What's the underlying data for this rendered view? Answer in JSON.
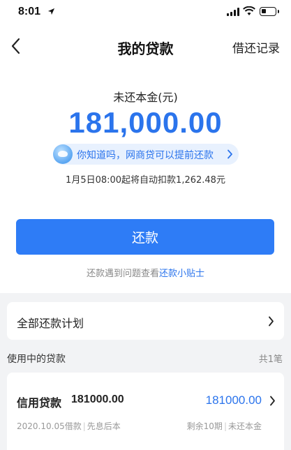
{
  "status_bar": {
    "time": "8:01"
  },
  "nav": {
    "title": "我的贷款",
    "right_action": "借还记录"
  },
  "summary": {
    "label": "未还本金(元)",
    "amount": "181,000.00",
    "tip": "你知道吗，网商贷可以提前还款",
    "auto_deduct": "1月5日08:00起将自动扣款1,262.48元"
  },
  "repay_button": "还款",
  "help": {
    "prefix": "还款遇到问题查看",
    "link": "还款小贴士"
  },
  "plan": {
    "label": "全部还款计划"
  },
  "loans_section": {
    "title": "使用中的贷款",
    "count": "共1笔"
  },
  "loan": {
    "name": "信用贷款",
    "principal": "181000.00",
    "remaining": "181000.00",
    "borrow_date": "2020.10.05借款",
    "repay_type": "先息后本",
    "periods_left": "剩余10期",
    "remaining_label": "未还本金"
  },
  "colors": {
    "accent": "#2b74ec",
    "button": "#2e7cf6",
    "background": "#f2f3f5"
  }
}
